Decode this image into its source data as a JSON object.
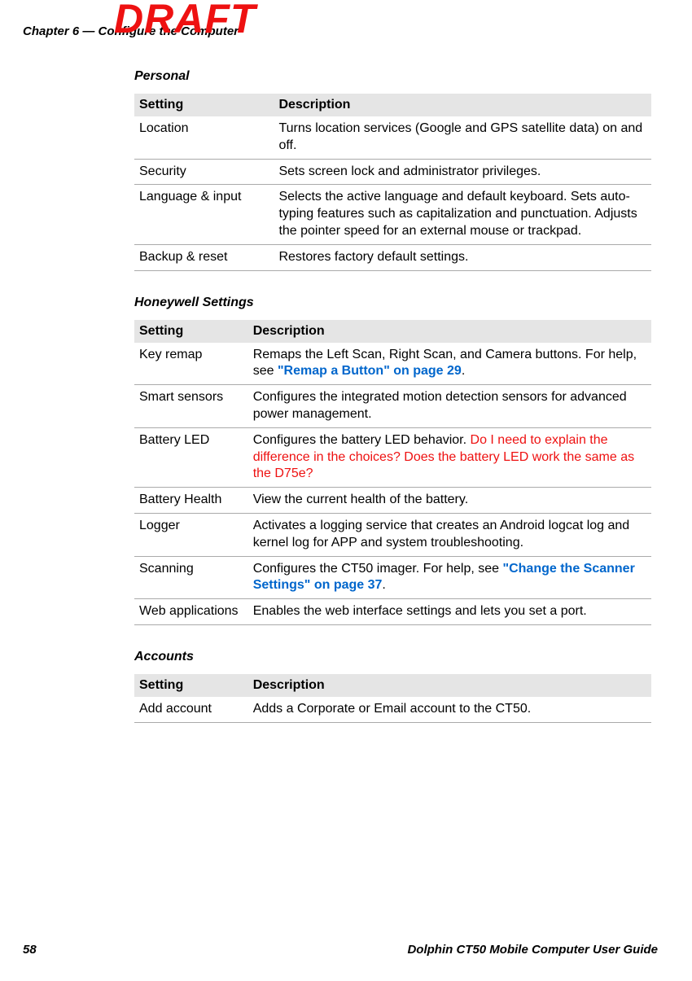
{
  "watermark": "DRAFT",
  "header": {
    "chapter": "Chapter 6 — Configure the Computer"
  },
  "sections": {
    "personal": {
      "title": "Personal",
      "headers": {
        "setting": "Setting",
        "description": "Description"
      },
      "rows": [
        {
          "setting": "Location",
          "description": "Turns location services (Google and GPS satellite data) on and off."
        },
        {
          "setting": "Security",
          "description": "Sets screen lock and administrator privileges."
        },
        {
          "setting": "Language & input",
          "description": "Selects the active language and default keyboard. Sets auto-typing features such as capitalization and punctuation. Adjusts the pointer speed for an external mouse or trackpad."
        },
        {
          "setting": "Backup & reset",
          "description": "Restores factory default settings."
        }
      ]
    },
    "honeywell": {
      "title": "Honeywell Settings",
      "headers": {
        "setting": "Setting",
        "description": "Description"
      },
      "rows": [
        {
          "setting": "Key remap",
          "description_pre": "Remaps the Left Scan, Right Scan, and Camera buttons. For help, see ",
          "link": "\"Remap a Button\" on page 29",
          "description_post": "."
        },
        {
          "setting": "Smart sensors",
          "description_pre": "Configures the integrated motion detection sensors for advanced power management.",
          "link": "",
          "description_post": ""
        },
        {
          "setting": "Battery LED",
          "description_pre": "Configures the battery LED behavior. ",
          "editorial": "Do I need to explain the difference in the choices? Does the battery LED work the same as the D75e?",
          "link": "",
          "description_post": ""
        },
        {
          "setting": "Battery Health",
          "description_pre": "View the current health of the battery.",
          "link": "",
          "description_post": ""
        },
        {
          "setting": "Logger",
          "description_pre": "Activates a logging service that creates an Android logcat log and kernel log for APP and system troubleshooting.",
          "link": "",
          "description_post": ""
        },
        {
          "setting": "Scanning",
          "description_pre": "Configures the CT50 imager. For help, see ",
          "link": "\"Change the Scanner Settings\" on page 37",
          "description_post": "."
        },
        {
          "setting": "Web applications",
          "description_pre": "Enables the web interface settings and lets you set a port.",
          "link": "",
          "description_post": ""
        }
      ]
    },
    "accounts": {
      "title": "Accounts",
      "headers": {
        "setting": "Setting",
        "description": "Description"
      },
      "rows": [
        {
          "setting": "Add account",
          "description": "Adds a Corporate or Email account to the CT50."
        }
      ]
    }
  },
  "footer": {
    "page": "58",
    "guide": "Dolphin CT50 Mobile Computer User Guide"
  }
}
